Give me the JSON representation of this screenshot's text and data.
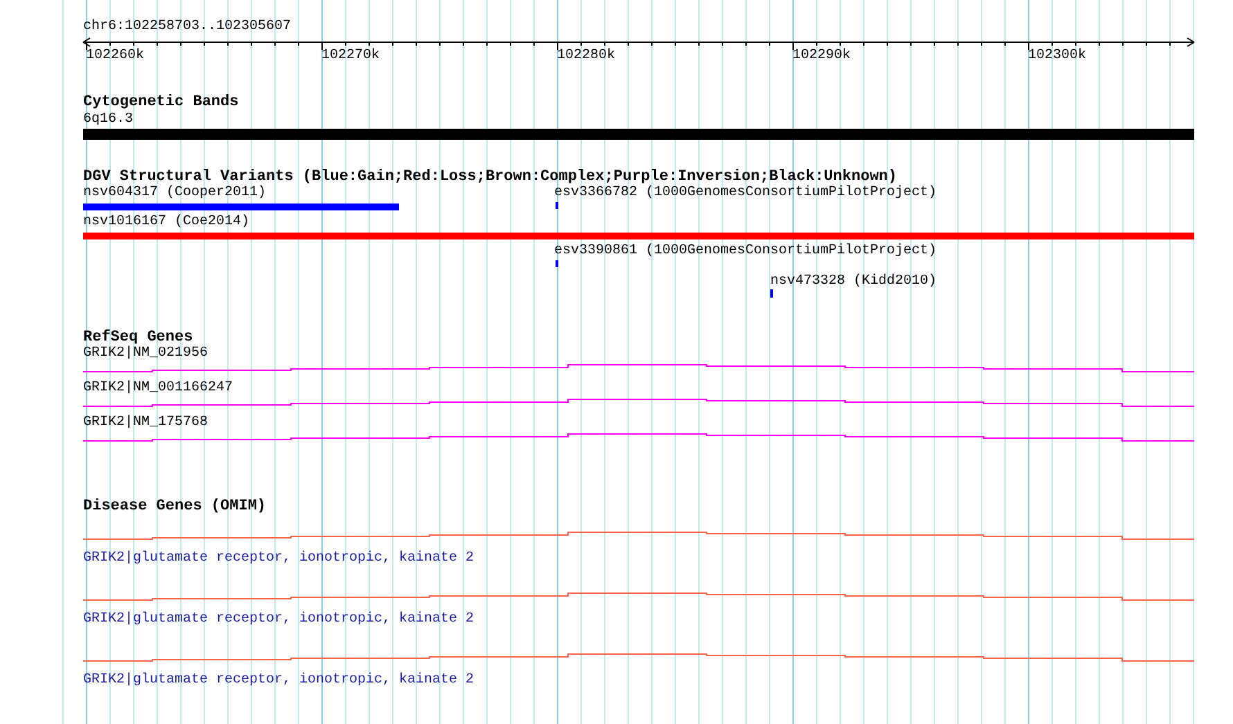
{
  "ruler": {
    "range": "chr6:102258703..102305607",
    "ticks": [
      "102260k",
      "102270k",
      "102280k",
      "102290k",
      "102300k"
    ]
  },
  "tracks": [
    {
      "kind": "cytoband",
      "title": "Cytogenetic Bands",
      "features": [
        {
          "label": "6q16.3"
        }
      ]
    },
    {
      "kind": "variants",
      "title": "DGV Structural Variants (Blue:Gain;Red:Loss;Brown:Complex;Purple:Inversion;Black:Unknown)",
      "features": [
        {
          "label": "nsv604317 (Cooper2011)",
          "color": "#0000ff"
        },
        {
          "label": "esv3366782 (1000GenomesConsortiumPilotProject)",
          "color": "#0000ff"
        },
        {
          "label": "nsv1016167 (Coe2014)",
          "color": "#ff0000"
        },
        {
          "label": "esv3390861 (1000GenomesConsortiumPilotProject)",
          "color": "#0000ff"
        },
        {
          "label": "nsv473328 (Kidd2010)",
          "color": "#0000ff"
        }
      ]
    },
    {
      "kind": "genes",
      "title": "RefSeq Genes",
      "features": [
        {
          "label": "GRIK2|NM_021956"
        },
        {
          "label": "GRIK2|NM_001166247"
        },
        {
          "label": "GRIK2|NM_175768"
        }
      ]
    },
    {
      "kind": "disease",
      "title": "Disease Genes (OMIM)",
      "features": [
        {
          "label": "GRIK2|glutamate receptor, ionotropic, kainate 2"
        },
        {
          "label": "GRIK2|glutamate receptor, ionotropic, kainate 2"
        },
        {
          "label": "GRIK2|glutamate receptor, ionotropic, kainate 2"
        }
      ]
    }
  ]
}
